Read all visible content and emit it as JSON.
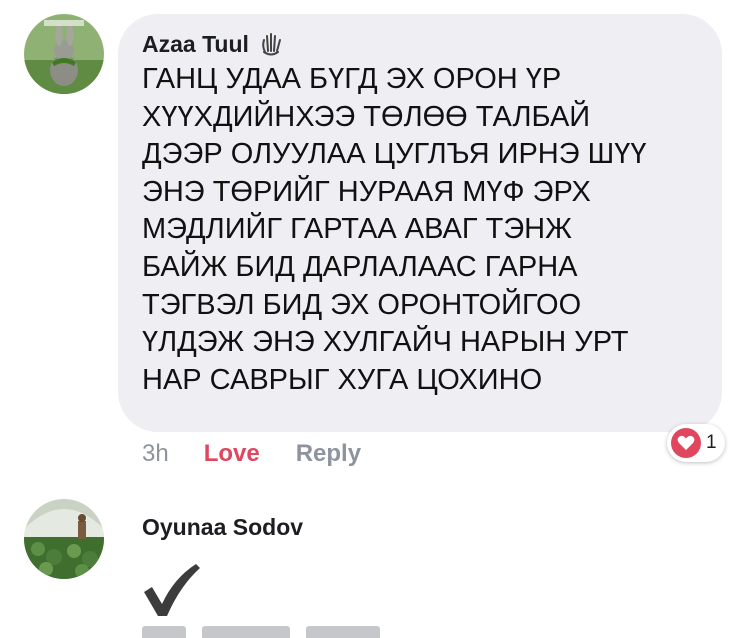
{
  "comments": [
    {
      "author": "Azaa Tuul",
      "author_badge_icon": "waving-hand-icon",
      "text_lines": [
        "ГАНЦ УДАА БҮГД ЭХ ОРОН ҮР",
        "ХҮҮХДИЙНХЭЭ ТӨЛӨӨ ТАЛБАЙ",
        "ДЭЭР ОЛУУЛАА ЦУГЛЪЯ ИРНЭ ШҮҮ",
        "ЭНЭ ТӨРИЙГ НУРААЯ МҮФ ЭРХ",
        "МЭДЛИЙГ ГАРТАА АВАГ ТЭНЖ",
        "БАЙЖ БИД ДАРЛАЛААС ГАРНА",
        "ТЭГВЭЛ БИД ЭХ ОРОНТОЙГОО",
        "ҮЛДЭЖ ЭНЭ ХУЛГАЙЧ НАРЫН УРТ",
        "НАР САВРЫГ ХУГА ЦОХИНО"
      ],
      "time": "3h",
      "love_label": "Love",
      "reply_label": "Reply",
      "reaction": {
        "icon": "heart-icon",
        "count": "1",
        "color": "#e0465e"
      }
    },
    {
      "author": "Oyunaa Sodov",
      "content_icon": "checkmark-icon"
    }
  ],
  "colors": {
    "bubble": "#efeff3",
    "name": "#1c1e21",
    "meta": "#8d949e",
    "love": "#e0465e"
  }
}
